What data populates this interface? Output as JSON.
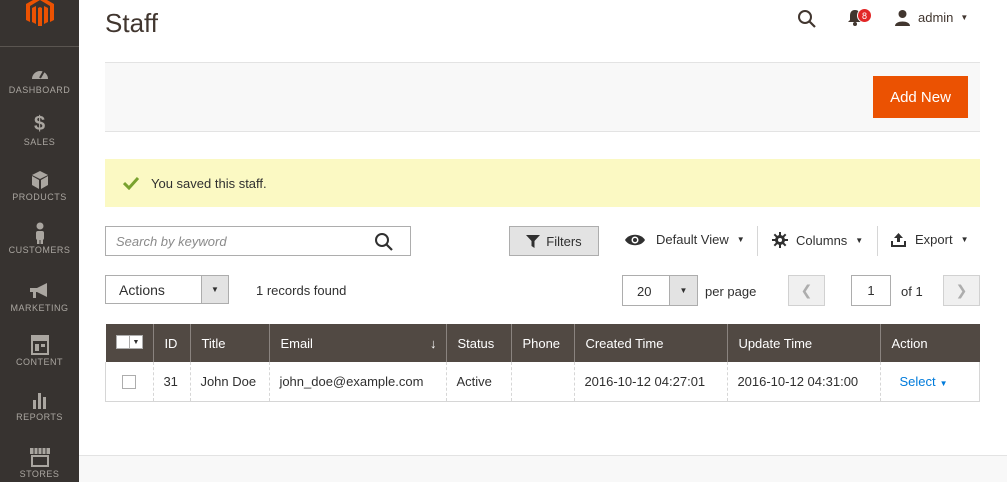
{
  "sidebar": {
    "items": [
      {
        "label": "DASHBOARD",
        "icon": "dashboard-icon"
      },
      {
        "label": "SALES",
        "icon": "dollar-icon"
      },
      {
        "label": "PRODUCTS",
        "icon": "cube-icon"
      },
      {
        "label": "CUSTOMERS",
        "icon": "person-icon"
      },
      {
        "label": "MARKETING",
        "icon": "megaphone-icon"
      },
      {
        "label": "CONTENT",
        "icon": "layout-icon"
      },
      {
        "label": "REPORTS",
        "icon": "bar-chart-icon"
      },
      {
        "label": "STORES",
        "icon": "store-icon"
      }
    ]
  },
  "header": {
    "title": "Staff",
    "notification_count": "8",
    "user": "admin"
  },
  "toolbar": {
    "add_new_label": "Add New"
  },
  "message": {
    "text": "You saved this staff."
  },
  "grid_controls": {
    "search_placeholder": "Search by keyword",
    "filters_label": "Filters",
    "view_label": "Default View",
    "columns_label": "Columns",
    "export_label": "Export",
    "actions_label": "Actions",
    "records_found": "1 records found",
    "per_page_value": "20",
    "per_page_label": "per page",
    "current_page": "1",
    "page_of": "of 1"
  },
  "table": {
    "columns": [
      "ID",
      "Title",
      "Email",
      "Status",
      "Phone",
      "Created Time",
      "Update Time",
      "Action"
    ],
    "rows": [
      {
        "id": "31",
        "title": "John Doe",
        "email": "john_doe@example.com",
        "status": "Active",
        "phone": "",
        "created": "2016-10-12 04:27:01",
        "updated": "2016-10-12 04:31:00",
        "action": "Select"
      }
    ]
  },
  "colors": {
    "accent": "#eb5202",
    "sidebar": "#373330",
    "table_header": "#514943",
    "link": "#007bdb",
    "success_bg": "#fbf9c3"
  }
}
